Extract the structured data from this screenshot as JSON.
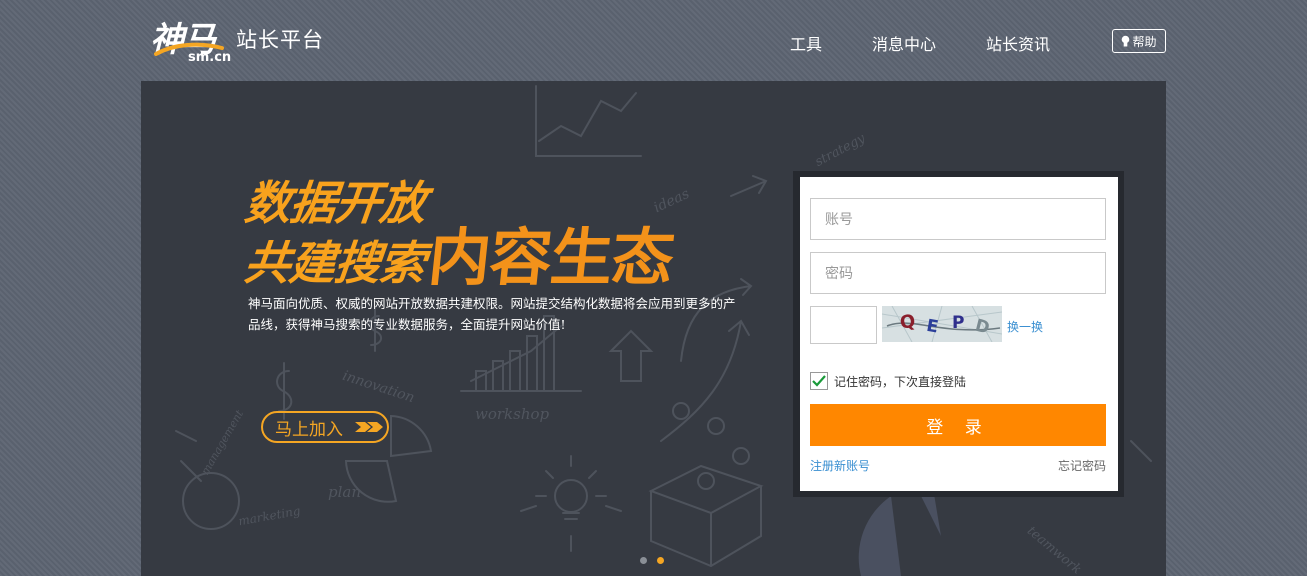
{
  "header": {
    "logo_cn": "神马",
    "logo_domain": "sm.cn",
    "platform": "站长平台",
    "nav": [
      "工具",
      "消息中心",
      "站长资讯"
    ],
    "help": "帮助"
  },
  "banner": {
    "headline_line1": "数据开放",
    "headline_line2": "共建搜索",
    "headline_big": "内容生态",
    "description": "神马面向优质、权威的网站开放数据共建权限。网站提交结构化数据将会应用到更多的产品线，获得神马搜索的专业数据服务，全面提升网站价值!",
    "join_label": "马上加入",
    "doodle_words": [
      "strategy",
      "ideas",
      "innovation",
      "workshop",
      "management",
      "plan",
      "marketing",
      "teamwork"
    ],
    "slides": 2,
    "active_slide": 2
  },
  "login": {
    "account_placeholder": "账号",
    "password_placeholder": "密码",
    "captcha_text": "QEPD",
    "captcha_refresh": "换一换",
    "remember_label": "记住密码，下次直接登陆",
    "remember_checked": true,
    "submit_label": "登 录",
    "register_label": "注册新账号",
    "forgot_label": "忘记密码"
  },
  "colors": {
    "page_bg": "#5d6572",
    "banner_bg": "#363a42",
    "accent_orange": "#ff8700",
    "headline_orange": "#f8a21d",
    "link_blue": "#3a8fd1"
  }
}
